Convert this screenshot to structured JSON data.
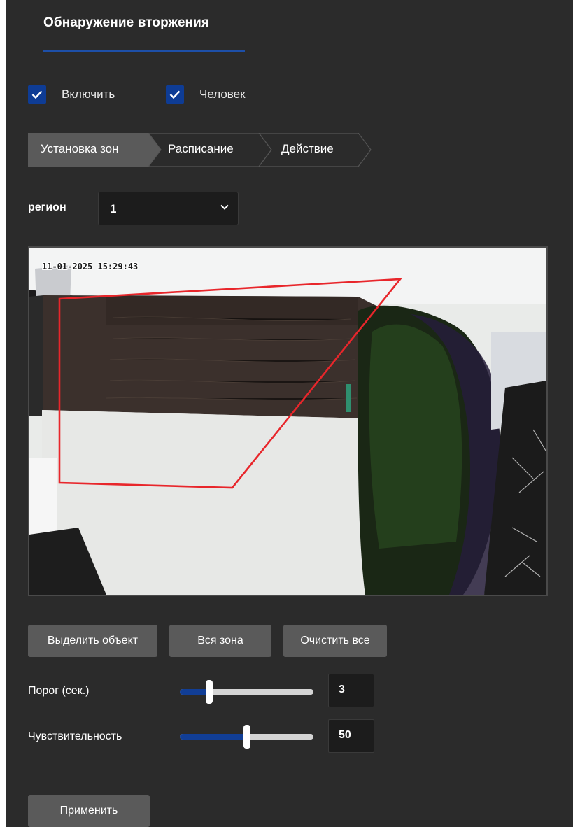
{
  "tabs": {
    "active_label": "Обнаружение вторжения"
  },
  "checkboxes": {
    "enable": {
      "label": "Включить",
      "checked": true
    },
    "human": {
      "label": "Человек",
      "checked": true
    }
  },
  "steps": [
    {
      "label": "Установка зон",
      "active": true
    },
    {
      "label": "Расписание",
      "active": false
    },
    {
      "label": "Действие",
      "active": false
    }
  ],
  "region": {
    "label": "регион",
    "selected": "1"
  },
  "video": {
    "osd_timestamp": "11-01-2025 15:29:43",
    "zone_color": "#e8262b"
  },
  "actions": {
    "select_object": "Выделить объект",
    "full_zone": "Вся зона",
    "clear_all": "Очистить все"
  },
  "threshold": {
    "label": "Порог (сек.)",
    "value": "3",
    "level_percent": 22
  },
  "sensitivity": {
    "label": "Чувствительность",
    "value": "50",
    "level_percent": 50
  },
  "apply_label": "Применить",
  "colors": {
    "accent": "#0e3c95",
    "background": "#2b2b2b",
    "button": "#5a5a5a"
  }
}
